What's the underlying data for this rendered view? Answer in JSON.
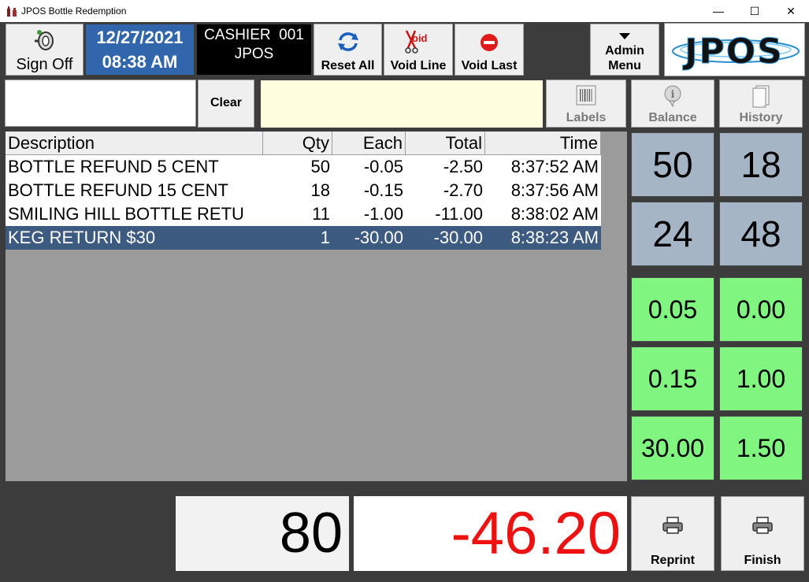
{
  "window": {
    "title": "JPOS Bottle Redemption",
    "minimize": "—",
    "maximize": "☐",
    "close": "✕"
  },
  "toolbar": {
    "sign_off": "Sign Off",
    "date": "12/27/2021",
    "time": "08:38 AM",
    "cashier_line": "CASHIER  001",
    "cashier_name": "JPOS",
    "reset_all": "Reset All",
    "void_line": "Void Line",
    "void_last": "Void Last",
    "admin_menu_line1": "Admin",
    "admin_menu_line2": "Menu",
    "logo_text": "JPOS"
  },
  "entry": {
    "value": "",
    "clear": "Clear",
    "labels": "Labels",
    "balance": "Balance",
    "history": "History"
  },
  "table": {
    "headers": [
      "Description",
      "Qty",
      "Each",
      "Total",
      "Time"
    ],
    "rows": [
      [
        "BOTTLE REFUND 5 CENT",
        "50",
        "-0.05",
        "-2.50",
        "8:37:52 AM"
      ],
      [
        "BOTTLE REFUND 15 CENT",
        "18",
        "-0.15",
        "-2.70",
        "8:37:56 AM"
      ],
      [
        "SMILING HILL BOTTLE RETU",
        "11",
        "-1.00",
        "-11.00",
        "8:38:02 AM"
      ],
      [
        "KEG RETURN $30",
        "1",
        "-30.00",
        "-30.00",
        "8:38:23 AM"
      ]
    ],
    "selected_row": 3
  },
  "keypad": {
    "qty_keys": [
      "50",
      "18",
      "24",
      "48"
    ],
    "amount_keys": [
      "0.05",
      "0.00",
      "0.15",
      "1.00",
      "30.00",
      "1.50"
    ]
  },
  "footer": {
    "item_count": "80",
    "grand_total": "-46.20",
    "reprint": "Reprint",
    "finish": "Finish"
  },
  "colors": {
    "date_bg": "#3166ac",
    "selected_row_bg": "#3d5b80",
    "qty_key_bg": "#a6b5c6",
    "amount_key_bg": "#80f580",
    "total_text": "#ee1111",
    "message_bg": "#ffffe0"
  }
}
